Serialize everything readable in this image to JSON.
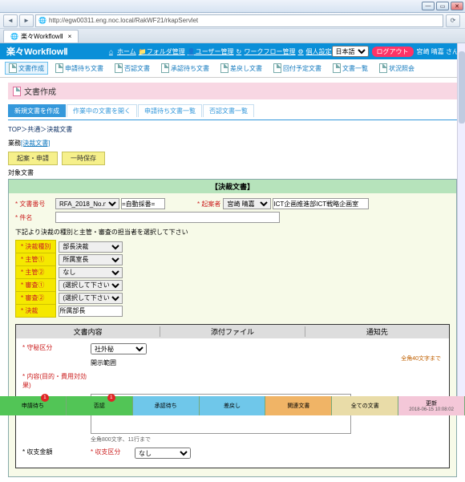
{
  "browser": {
    "url": "http://egw00311.eng.noc.local/RakWF21/rkapServlet",
    "tab_title": "楽々WorkflowⅡ"
  },
  "app": {
    "brand": "楽々WorkflowⅡ",
    "menu": {
      "home": "ホーム",
      "folder": "フォルダ管理",
      "user": "ユーザー管理",
      "flow": "ワークフロー管理",
      "personal": "個人設定"
    },
    "lang": "日本語",
    "logout": "ログアウト",
    "user": "宮崎 晴嘉 さん"
  },
  "subnav": {
    "create": "文書作成",
    "applied": "申請待ち文書",
    "approve": "否認文書",
    "pending": "承認待ち文書",
    "returned": "差戻し文書",
    "scheduled": "回付予定文書",
    "list": "文書一覧",
    "status": "状況照会"
  },
  "page": {
    "title": "文書作成",
    "tabs": {
      "t1": "新規文書を作成",
      "t2": "作業中の文書を開く",
      "t3": "申請待ち文書一覧",
      "t4": "否認文書一覧"
    },
    "breadcrumb": "TOP＞共通＞決裁文書",
    "task_prefix": "業務",
    "task_link": "[決裁文書]",
    "btn_apply": "起案・申請",
    "btn_save": "一時保存",
    "target_label": "対象文書"
  },
  "mainbox": {
    "title": "【決裁文書】",
    "doc_no_lbl": "文書番号",
    "doc_no_select": "RFA_2018_No.n",
    "doc_no_opt": "=自動採番=",
    "originator_lbl": "起案者",
    "originator_val": "宮崎 晴嘉",
    "originator_dept": "ICT企画推進部ICT戦略企画室",
    "subject_lbl": "件名",
    "subject_val": "",
    "hint": "下記より決裁の種別と主管・審査の担当者を選択して下さい",
    "rows": {
      "kind_lbl": "決裁種別",
      "kind_val": "部長決裁",
      "m1_lbl": "主管①",
      "m1_val": "所属室長",
      "m2_lbl": "主管②",
      "m2_val": "なし",
      "s1_lbl": "審査①",
      "s1_val": "(選択して下さい)",
      "s2_lbl": "審査②",
      "s2_val": "(選択して下さい)",
      "dec_lbl": "決裁",
      "dec_val": "所属部長"
    }
  },
  "innerbox": {
    "col1": "文書内容",
    "col2": "添付ファイル",
    "col3": "通知先",
    "secrecy_lbl": "守秘区分",
    "secrecy_val": "社外秘",
    "scope_lbl": "開示範囲",
    "scope_hint": "全角40文字まで",
    "content_lbl": "内容(目的・費用対効果)",
    "ta_note": "全角800文字、11行まで",
    "budget_lbl": "収支金額",
    "class_lbl": "収支区分",
    "class_val": "なし"
  },
  "statusbar": {
    "s1": "申請待ち",
    "s2": "否認",
    "s3": "承認待ち",
    "s4": "差戻し",
    "s5": "関連文書",
    "s6": "全ての文書",
    "s7_top": "更新",
    "s7_bottom": "2018-06-15 10:08:02",
    "badge1": "1",
    "badge2": "1"
  }
}
